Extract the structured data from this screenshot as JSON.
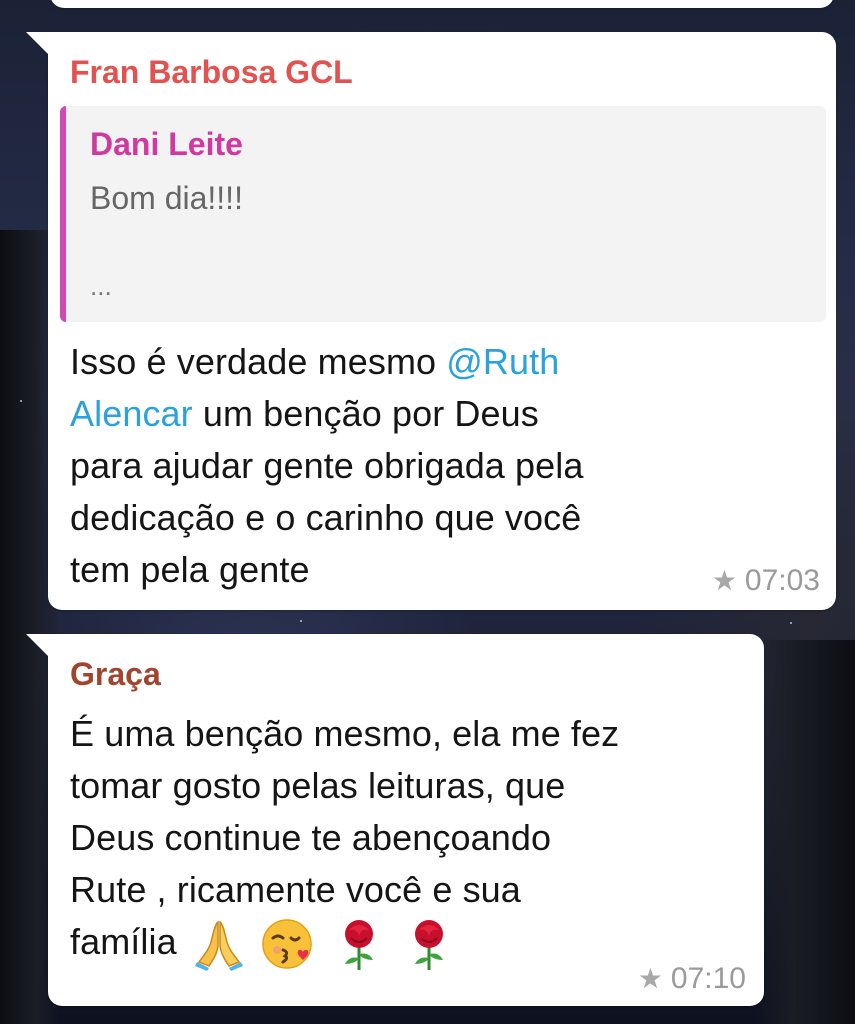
{
  "messages": [
    {
      "sender": "Fran Barbosa GCL",
      "quote": {
        "author": "Dani Leite",
        "text": "Bom dia!!!!",
        "more": "..."
      },
      "text_before_mention": "Isso é verdade mesmo ",
      "mention_part1": "@Ruth",
      "mention_part2": "Alencar",
      "text_after_mention": " um benção por Deus",
      "text_line3": "para ajudar gente  obrigada pela",
      "text_line4": "dedicação e o carinho que você",
      "text_line5": "tem pela gente",
      "time": "07:03",
      "starred": true
    },
    {
      "sender": "Graça",
      "lines": [
        "É uma benção mesmo, ela me fez",
        "tomar gosto pelas leituras, que",
        "Deus continue te abençoando",
        "Rute , ricamente você e sua",
        "família"
      ],
      "emojis": [
        "praying-hands",
        "kissing-face",
        "rose",
        "rose"
      ],
      "time": "07:10",
      "starred": true
    }
  ],
  "colors": {
    "sender_1": "#e2524f",
    "sender_2": "#a2452f",
    "quote_author": "#d0399f",
    "quote_bar": "#d448b3",
    "mention": "#2aa3dd",
    "meta": "#9a9a9a"
  }
}
